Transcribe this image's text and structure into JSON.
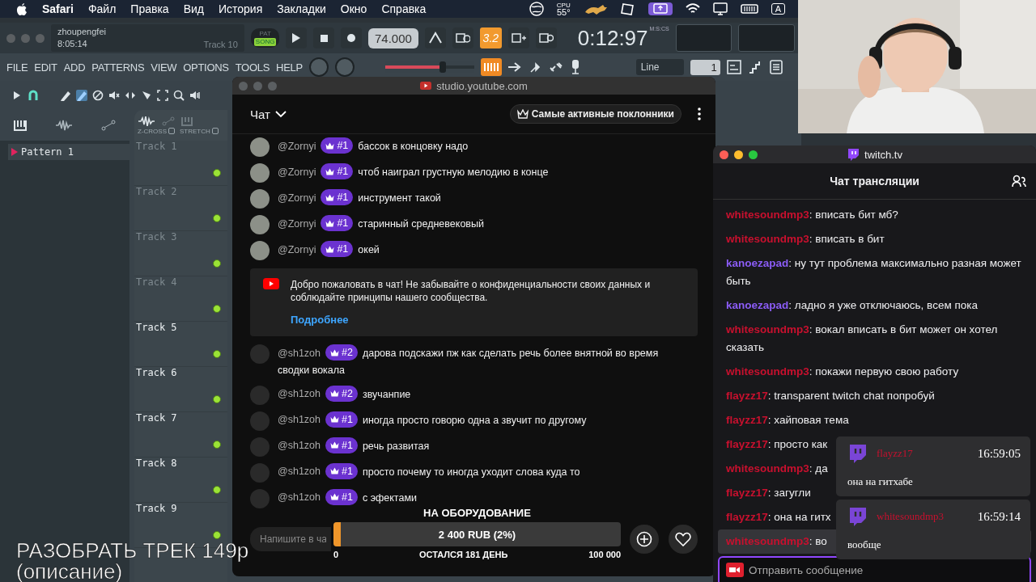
{
  "menubar": {
    "app": "Safari",
    "menus": [
      "Файл",
      "Правка",
      "Вид",
      "История",
      "Закладки",
      "Окно",
      "Справка"
    ],
    "cpu_label": "CPU",
    "cpu_temp": "55°",
    "input_source": "A"
  },
  "daw": {
    "user": "zhoupengfei",
    "time": "8:05:14",
    "hint": "Track 10",
    "modes": [
      {
        "label": "PAT",
        "selected": false
      },
      {
        "label": "SONG",
        "selected": true
      }
    ],
    "tempo": "74.000",
    "counter_badge": "3.2",
    "clock": "0:12:97",
    "clock_unit": "M:S:CS",
    "menus": [
      "FILE",
      "EDIT",
      "ADD",
      "PATTERNS",
      "VIEW",
      "OPTIONS",
      "TOOLS",
      "HELP"
    ],
    "master": {
      "level": 0.65
    },
    "snap": "Line",
    "step": "1",
    "toggles": [
      "Z-CROSS",
      "STRETCH"
    ],
    "patterns": [
      {
        "name": "Pattern 1",
        "selected": true
      }
    ],
    "tracks": [
      {
        "name": "Track 1",
        "dimmed": true
      },
      {
        "name": "Track 2",
        "dimmed": true
      },
      {
        "name": "Track 3",
        "dimmed": true
      },
      {
        "name": "Track 4",
        "dimmed": true
      },
      {
        "name": "Track 5",
        "dimmed": false
      },
      {
        "name": "Track 6",
        "dimmed": false
      },
      {
        "name": "Track 7",
        "dimmed": false
      },
      {
        "name": "Track 8",
        "dimmed": false
      },
      {
        "name": "Track 9",
        "dimmed": false
      }
    ]
  },
  "youtube": {
    "url": "studio.youtube.com",
    "title": "Чат",
    "top_fans": "Самые активные поклонники",
    "messages": [
      {
        "author": "@Zornyi",
        "rank": "#1",
        "text": "бассок в концовку надо",
        "color": "#8c9088"
      },
      {
        "author": "@Zornyi",
        "rank": "#1",
        "text": "чтоб наиграл грустную мелодию в конце",
        "color": "#8c9088"
      },
      {
        "author": "@Zornyi",
        "rank": "#1",
        "text": "инструмент такой",
        "color": "#8c9088"
      },
      {
        "author": "@Zornyi",
        "rank": "#1",
        "text": "старинный средневековый",
        "color": "#8c9088"
      },
      {
        "author": "@Zornyi",
        "rank": "#1",
        "text": "окей",
        "color": "#8c9088"
      }
    ],
    "notice": {
      "text": "Добро пожаловать в чат! Не забывайте о конфиденциальности своих данных и соблюдайте принципы нашего сообщества.",
      "link": "Подробнее"
    },
    "messages_after": [
      {
        "author": "@sh1zoh",
        "rank": "#2",
        "text": "дарова подскажи пж как сделать речь более внятной во время сводки вокала",
        "color": "#2a2a2a"
      },
      {
        "author": "@sh1zoh",
        "rank": "#2",
        "text": "звучанпие",
        "color": "#2a2a2a"
      },
      {
        "author": "@sh1zoh",
        "rank": "#1",
        "text": "иногда просто говорю одна а звучит по другому",
        "color": "#2a2a2a"
      },
      {
        "author": "@sh1zoh",
        "rank": "#1",
        "text": "речь развитая",
        "color": "#2a2a2a"
      },
      {
        "author": "@sh1zoh",
        "rank": "#1",
        "text": "просто почему то иногда уходит слова куда то",
        "color": "#2a2a2a"
      },
      {
        "author": "@sh1zoh",
        "rank": "#1",
        "text": "с эфектами",
        "color": "#2a2a2a"
      }
    ],
    "input_placeholder": "Напишите в ча",
    "goal": {
      "title": "НА ОБОРУДОВАНИЕ",
      "amount": "2 400 RUB (2%)",
      "level": 0.024,
      "min": "0",
      "remaining": "ОСТАЛСЯ 181 ДЕНЬ",
      "max": "100 000"
    }
  },
  "twitch": {
    "url": "twitch.tv",
    "title": "Чат трансляции",
    "messages": [
      {
        "user": "whitesoundmp3",
        "color": "#c8102e",
        "text": ": вписать бит мб?",
        "highlighted": false
      },
      {
        "user": "whitesoundmp3",
        "color": "#c8102e",
        "text": ": вписать в бит",
        "highlighted": false
      },
      {
        "user": "kanoezapad",
        "color": "#8b5cf6",
        "text": ": ну тут проблема максимально разная может быть",
        "highlighted": false
      },
      {
        "user": "kanoezapad",
        "color": "#8b5cf6",
        "text": ": ладно я уже отключаюсь, всем пока",
        "highlighted": false
      },
      {
        "user": "whitesoundmp3",
        "color": "#c8102e",
        "text": ": вокал вписать в бит может он хотел сказать",
        "highlighted": false
      },
      {
        "user": "whitesoundmp3",
        "color": "#c8102e",
        "text": ": покажи первую свою работу",
        "highlighted": false
      },
      {
        "user": "flayzz17",
        "color": "#c8102e",
        "text": ": transparent twitch chat попробуй",
        "highlighted": false
      },
      {
        "user": "flayzz17",
        "color": "#c8102e",
        "text": ": хайповая тема",
        "highlighted": false
      },
      {
        "user": "flayzz17",
        "color": "#c8102e",
        "text": ": просто как",
        "highlighted": false
      },
      {
        "user": "whitesoundmp3",
        "color": "#c8102e",
        "text": ": да",
        "highlighted": false
      },
      {
        "user": "flayzz17",
        "color": "#c8102e",
        "text": ": загугли",
        "highlighted": false
      },
      {
        "user": "flayzz17",
        "color": "#c8102e",
        "text": ": она на гитх",
        "highlighted": false
      },
      {
        "user": "whitesoundmp3",
        "color": "#c8102e",
        "text": ": во",
        "highlighted": true
      }
    ],
    "notifications": [
      {
        "user": "flayzz17",
        "color": "#c8102e",
        "time": "16:59:05",
        "text": "она на гитхабе"
      },
      {
        "user": "whitesoundmp3",
        "color": "#c8102e",
        "time": "16:59:14",
        "text": "вообще"
      }
    ],
    "input_placeholder": "Отправить сообщение"
  },
  "stream_overlay": {
    "lines": [
      "РАЗОБРАТЬ ТРЕК 149р",
      "(описание)"
    ]
  }
}
